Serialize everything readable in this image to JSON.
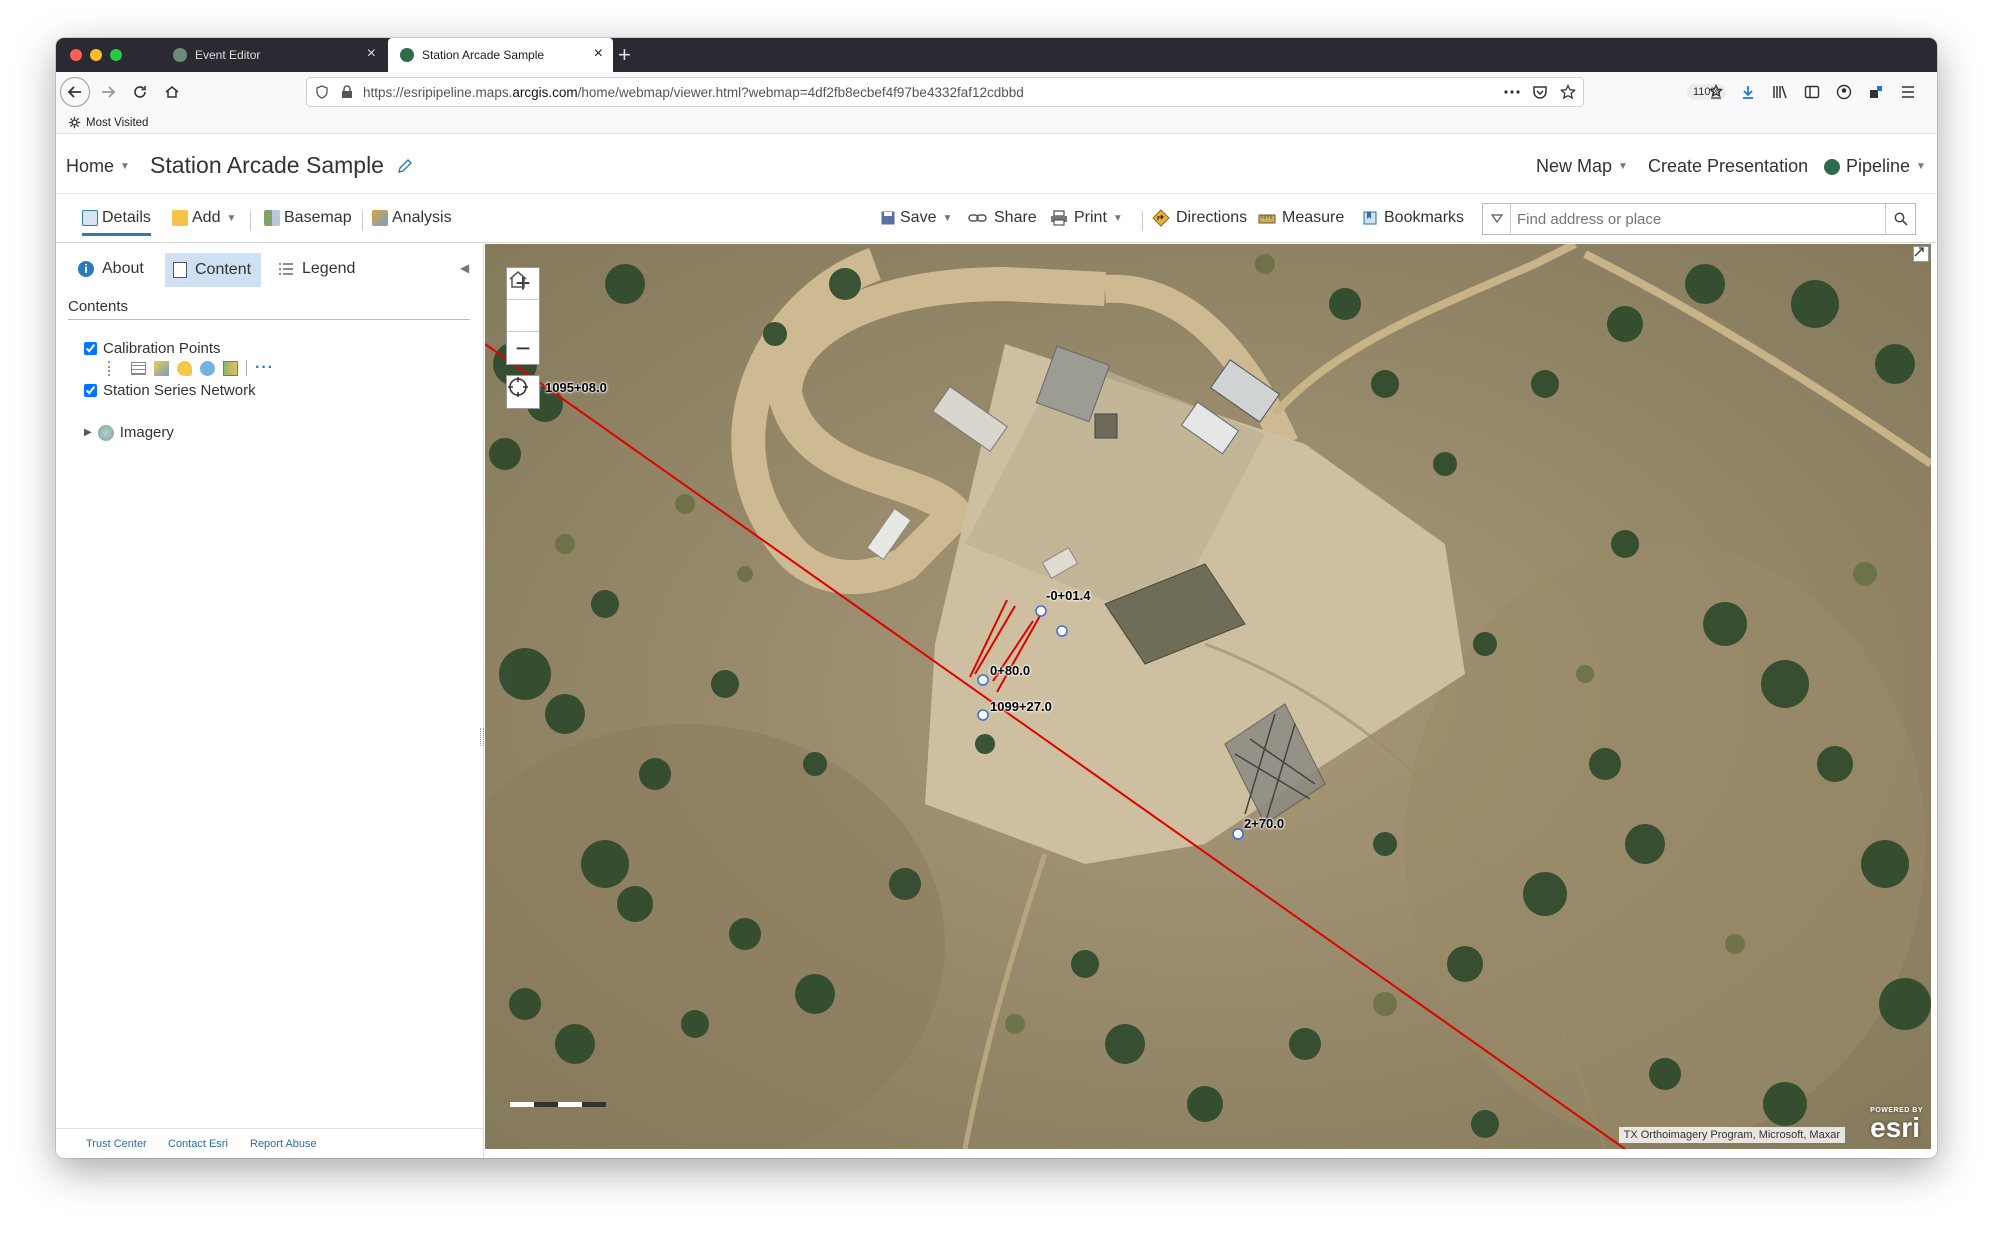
{
  "browser": {
    "tabs": [
      {
        "label": "Event Editor",
        "active": false
      },
      {
        "label": "Station Arcade Sample",
        "active": true
      }
    ],
    "url_prefix": "https://esripipeline.maps.",
    "url_host": "arcgis.com",
    "url_path": "/home/webmap/viewer.html?webmap=4df2fb8ecbef4f97be4332faf12cdbbd",
    "zoom": "110%",
    "bookmarks_label": "Most Visited"
  },
  "header": {
    "home_label": "Home",
    "map_title": "Station Arcade Sample",
    "new_map_label": "New Map",
    "create_presentation_label": "Create Presentation",
    "org_label": "Pipeline"
  },
  "toolbar": {
    "details_label": "Details",
    "add_label": "Add",
    "basemap_label": "Basemap",
    "analysis_label": "Analysis",
    "save_label": "Save",
    "share_label": "Share",
    "print_label": "Print",
    "directions_label": "Directions",
    "measure_label": "Measure",
    "bookmarks_label": "Bookmarks",
    "search_placeholder": "Find address or place"
  },
  "sidepanel": {
    "tabs": {
      "about": "About",
      "content": "Content",
      "legend": "Legend"
    },
    "contents_heading": "Contents",
    "layers": [
      {
        "label": "Calibration Points",
        "checked": true
      },
      {
        "label": "Station Series Network",
        "checked": true
      },
      {
        "label": "Imagery",
        "checked": false
      }
    ],
    "footer": {
      "trust": "Trust Center",
      "contact": "Contact Esri",
      "abuse": "Report Abuse"
    }
  },
  "map": {
    "labels": [
      "1095+08.0",
      "-0+01.4",
      "0+80.0",
      "1099+27.0",
      "2+70.0"
    ],
    "attribution": "TX Orthoimagery Program, Microsoft, Maxar",
    "powered_by": "POWERED BY",
    "esri": "esri",
    "line_color": "#e00000"
  }
}
